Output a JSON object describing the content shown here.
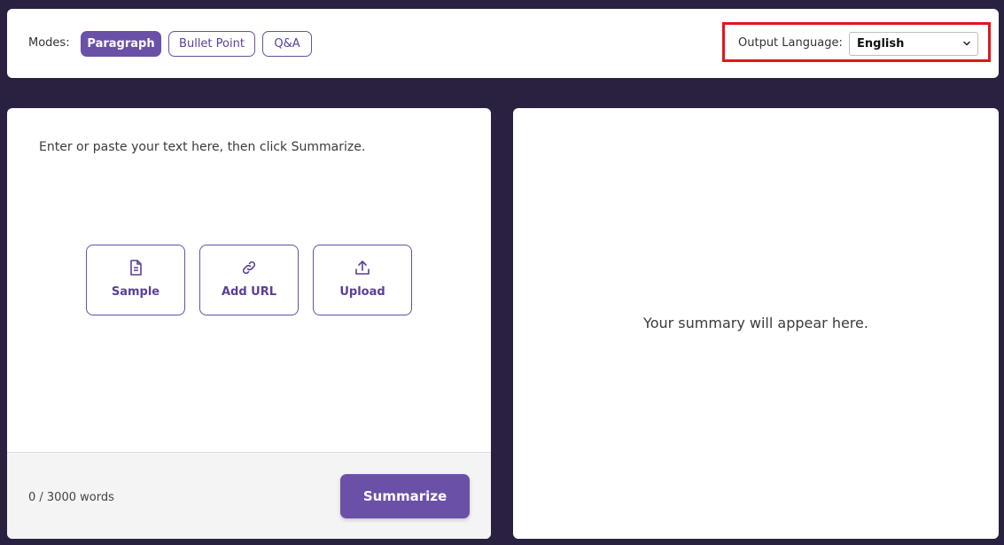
{
  "toolbar": {
    "modes_label": "Modes:",
    "modes": [
      {
        "label": "Paragraph",
        "active": true
      },
      {
        "label": "Bullet Point",
        "active": false
      },
      {
        "label": "Q&A",
        "active": false
      }
    ],
    "output_language_label": "Output Language:",
    "output_language_value": "English"
  },
  "input_panel": {
    "placeholder": "Enter or paste your text here, then click Summarize.",
    "actions": [
      {
        "label": "Sample",
        "icon": "document-icon"
      },
      {
        "label": "Add URL",
        "icon": "link-icon"
      },
      {
        "label": "Upload",
        "icon": "upload-icon"
      }
    ],
    "word_count": "0 / 3000 words",
    "summarize_label": "Summarize"
  },
  "output_panel": {
    "placeholder": "Your summary will appear here."
  },
  "colors": {
    "background": "#2a2141",
    "accent": "#6b50a8",
    "highlight_border": "#e3151b"
  }
}
